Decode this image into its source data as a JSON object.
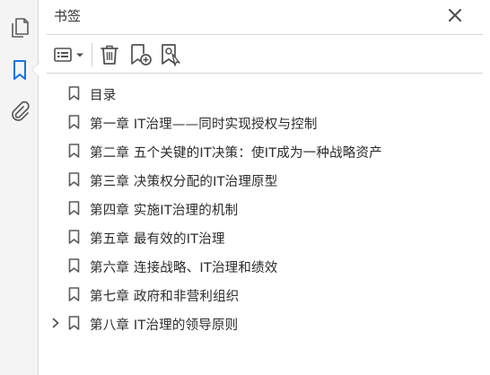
{
  "panel": {
    "title": "书签"
  },
  "rail": {
    "icons": [
      "pages-icon",
      "bookmark-icon",
      "attachment-icon"
    ],
    "active_color": "#1473e6"
  },
  "toolbar": {
    "buttons": [
      "options-menu-icon",
      "delete-icon",
      "new-bookmark-icon",
      "new-bookmark-from-structure-icon"
    ]
  },
  "bookmarks": [
    {
      "label": "目录",
      "expandable": false
    },
    {
      "label": "第一章  IT治理——同时实现授权与控制",
      "expandable": false
    },
    {
      "label": "第二章  五个关键的IT决策：使IT成为一种战略资产",
      "expandable": false
    },
    {
      "label": "第三章  决策权分配的IT治理原型",
      "expandable": false
    },
    {
      "label": "第四章  实施IT治理的机制",
      "expandable": false
    },
    {
      "label": "第五章  最有效的IT治理",
      "expandable": false
    },
    {
      "label": "第六章  连接战略、IT治理和绩效",
      "expandable": false
    },
    {
      "label": "第七章  政府和非营利组织",
      "expandable": false
    },
    {
      "label": "第八章  IT治理的领导原则",
      "expandable": true
    }
  ]
}
